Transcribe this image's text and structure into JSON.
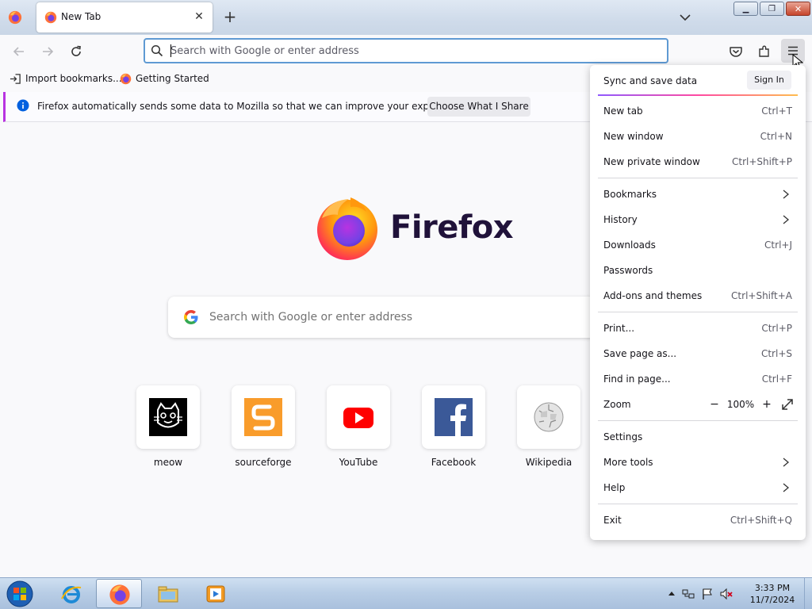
{
  "browser": {
    "tab": {
      "title": "New Tab"
    },
    "urlbar": {
      "placeholder": "Search with Google or enter address"
    },
    "bookmarks": [
      {
        "label": "Import bookmarks..."
      },
      {
        "label": "Getting Started"
      }
    ],
    "notification": {
      "text": "Firefox automatically sends some data to Mozilla so that we can improve your experience.",
      "button": "Choose What I Share"
    }
  },
  "newtab": {
    "brand": "Firefox",
    "search_placeholder": "Search with Google or enter address",
    "shortcuts": [
      {
        "label": "meow",
        "icon": "meow-cat-icon"
      },
      {
        "label": "sourceforge",
        "icon": "sourceforge-icon"
      },
      {
        "label": "YouTube",
        "icon": "youtube-icon"
      },
      {
        "label": "Facebook",
        "icon": "facebook-icon"
      },
      {
        "label": "Wikipedia",
        "icon": "wikipedia-icon"
      }
    ]
  },
  "app_menu": {
    "sync": {
      "label": "Sync and save data",
      "button": "Sign In"
    },
    "items": [
      {
        "label": "New tab",
        "shortcut": "Ctrl+T"
      },
      {
        "label": "New window",
        "shortcut": "Ctrl+N"
      },
      {
        "label": "New private window",
        "shortcut": "Ctrl+Shift+P"
      },
      {
        "label": "Bookmarks",
        "shortcut": ""
      },
      {
        "label": "History",
        "shortcut": ""
      },
      {
        "label": "Downloads",
        "shortcut": "Ctrl+J"
      },
      {
        "label": "Passwords",
        "shortcut": ""
      },
      {
        "label": "Add-ons and themes",
        "shortcut": "Ctrl+Shift+A"
      },
      {
        "label": "Print...",
        "shortcut": "Ctrl+P"
      },
      {
        "label": "Save page as...",
        "shortcut": "Ctrl+S"
      },
      {
        "label": "Find in page...",
        "shortcut": "Ctrl+F"
      },
      {
        "label": "Zoom",
        "shortcut": ""
      },
      {
        "label": "Settings",
        "shortcut": ""
      },
      {
        "label": "More tools",
        "shortcut": ""
      },
      {
        "label": "Help",
        "shortcut": ""
      },
      {
        "label": "Exit",
        "shortcut": "Ctrl+Shift+Q"
      }
    ],
    "zoom": {
      "minus": "−",
      "value": "100%",
      "plus": "+"
    }
  },
  "taskbar": {
    "apps": [
      "internet-explorer-icon",
      "firefox-icon",
      "file-explorer-icon",
      "media-player-icon"
    ],
    "clock": {
      "time": "3:33 PM",
      "date": "11/7/2024"
    }
  },
  "colors": {
    "accent": "#5f9ad3",
    "notification_border": "#b833e1",
    "brand_text": "#20123a"
  }
}
